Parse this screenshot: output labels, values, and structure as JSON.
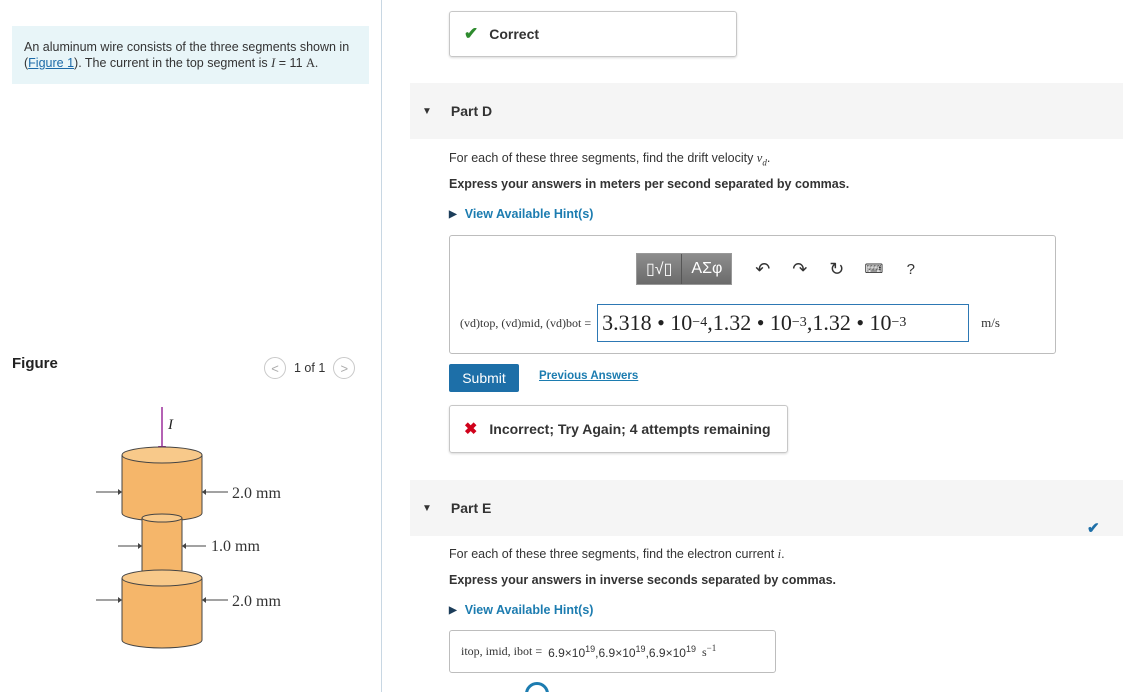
{
  "left": {
    "intro_text": "An aluminum wire consists of the three segments shown in (",
    "intro_link": "Figure 1",
    "intro_text2": "). The current in the top segment is ",
    "intro_var": "I",
    "intro_eq": " = 11 ",
    "intro_unit": "A.",
    "figure_label": "Figure",
    "pager_text": "1 of 1",
    "prev_icon": "chevron-left",
    "next_icon": "chevron-right"
  },
  "figure": {
    "current_label": "I",
    "top_dim": "2.0 mm",
    "mid_dim": "1.0 mm",
    "bot_dim": "2.0 mm",
    "wire_color": "#f5b66a",
    "wire_stroke": "#444444",
    "arrow_color": "#9b2d9b"
  },
  "status_correct": "Correct",
  "part_d": {
    "title": "Part D",
    "question_pre": "For each of these three segments, find the drift velocity ",
    "question_var": "v",
    "question_sub": "d",
    "question_post": ".",
    "instruction": "Express your answers in meters per second separated by commas.",
    "hint": "View Available Hint(s)",
    "toolbar": {
      "templates_label": "▯√▯",
      "greek_label": "ΑΣφ",
      "undo_icon": "undo-icon",
      "redo_icon": "redo-icon",
      "reset_icon": "reset-icon",
      "keyboard_icon": "keyboard-icon",
      "help_label": "?"
    },
    "eq_label": "(vd)top, (vd)mid, (vd)bot =",
    "answer": {
      "m1": "3.318",
      "dot": "•",
      "b1": "10",
      "e1": "−4",
      "m2": ",1.32",
      "b2": "10",
      "e2": "−3",
      "m3": ",1.32",
      "b3": "10",
      "e3": "−3"
    },
    "unit": "m/s",
    "submit": "Submit",
    "previous_answers": "Previous Answers",
    "feedback": "Incorrect; Try Again; 4 attempts remaining"
  },
  "part_e": {
    "title": "Part E",
    "question_pre": "For each of these three segments, find the electron current ",
    "question_var": "i",
    "question_post": ".",
    "instruction": "Express your answers in inverse seconds separated by commas.",
    "hint": "View Available Hint(s)",
    "eq_label": "itop, imid, ibot =",
    "answer": {
      "a1": "6.9×10",
      "p1": "19",
      "a2": ",6.9×10",
      "p2": "19",
      "a3": ",6.9×10",
      "p3": "19"
    },
    "unit_base": "s",
    "unit_exp": "−1"
  }
}
